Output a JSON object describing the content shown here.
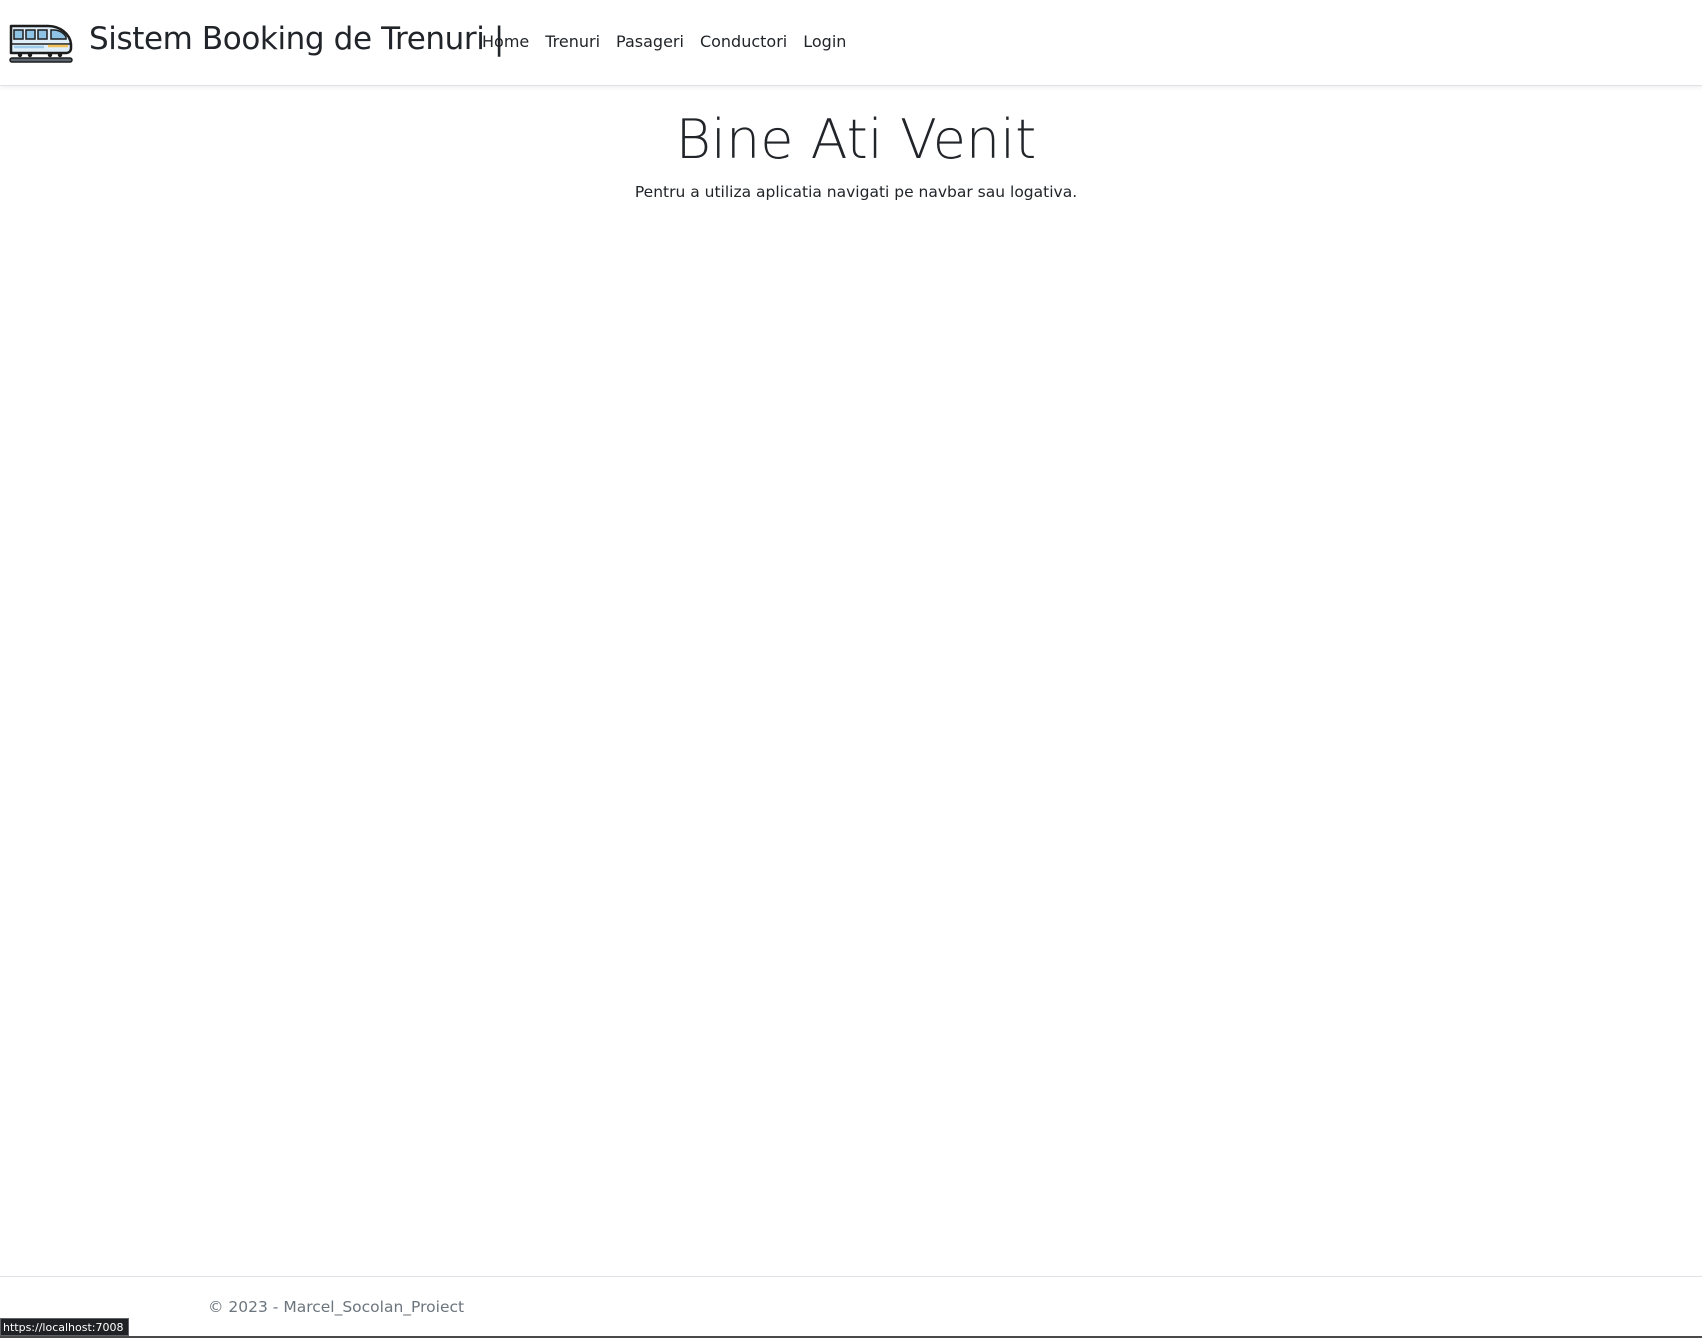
{
  "navbar": {
    "logo_icon": "train-icon",
    "brand_title": "Sistem Booking de Trenuri |",
    "links": [
      {
        "label": "Home"
      },
      {
        "label": "Trenuri"
      },
      {
        "label": "Pasageri"
      },
      {
        "label": "Conductori"
      },
      {
        "label": "Login"
      }
    ]
  },
  "main": {
    "heading": "Bine Ati Venit",
    "subtitle": "Pentru a utiliza aplicatia navigati pe navbar sau logativa."
  },
  "footer": {
    "copyright": "© 2023 - Marcel_Socolan_Proiect"
  },
  "status_bar": {
    "url": "https://localhost:7008"
  },
  "colors": {
    "text": "#212529",
    "muted": "#6c757d",
    "border": "#dee2e6",
    "background": "#ffffff"
  }
}
